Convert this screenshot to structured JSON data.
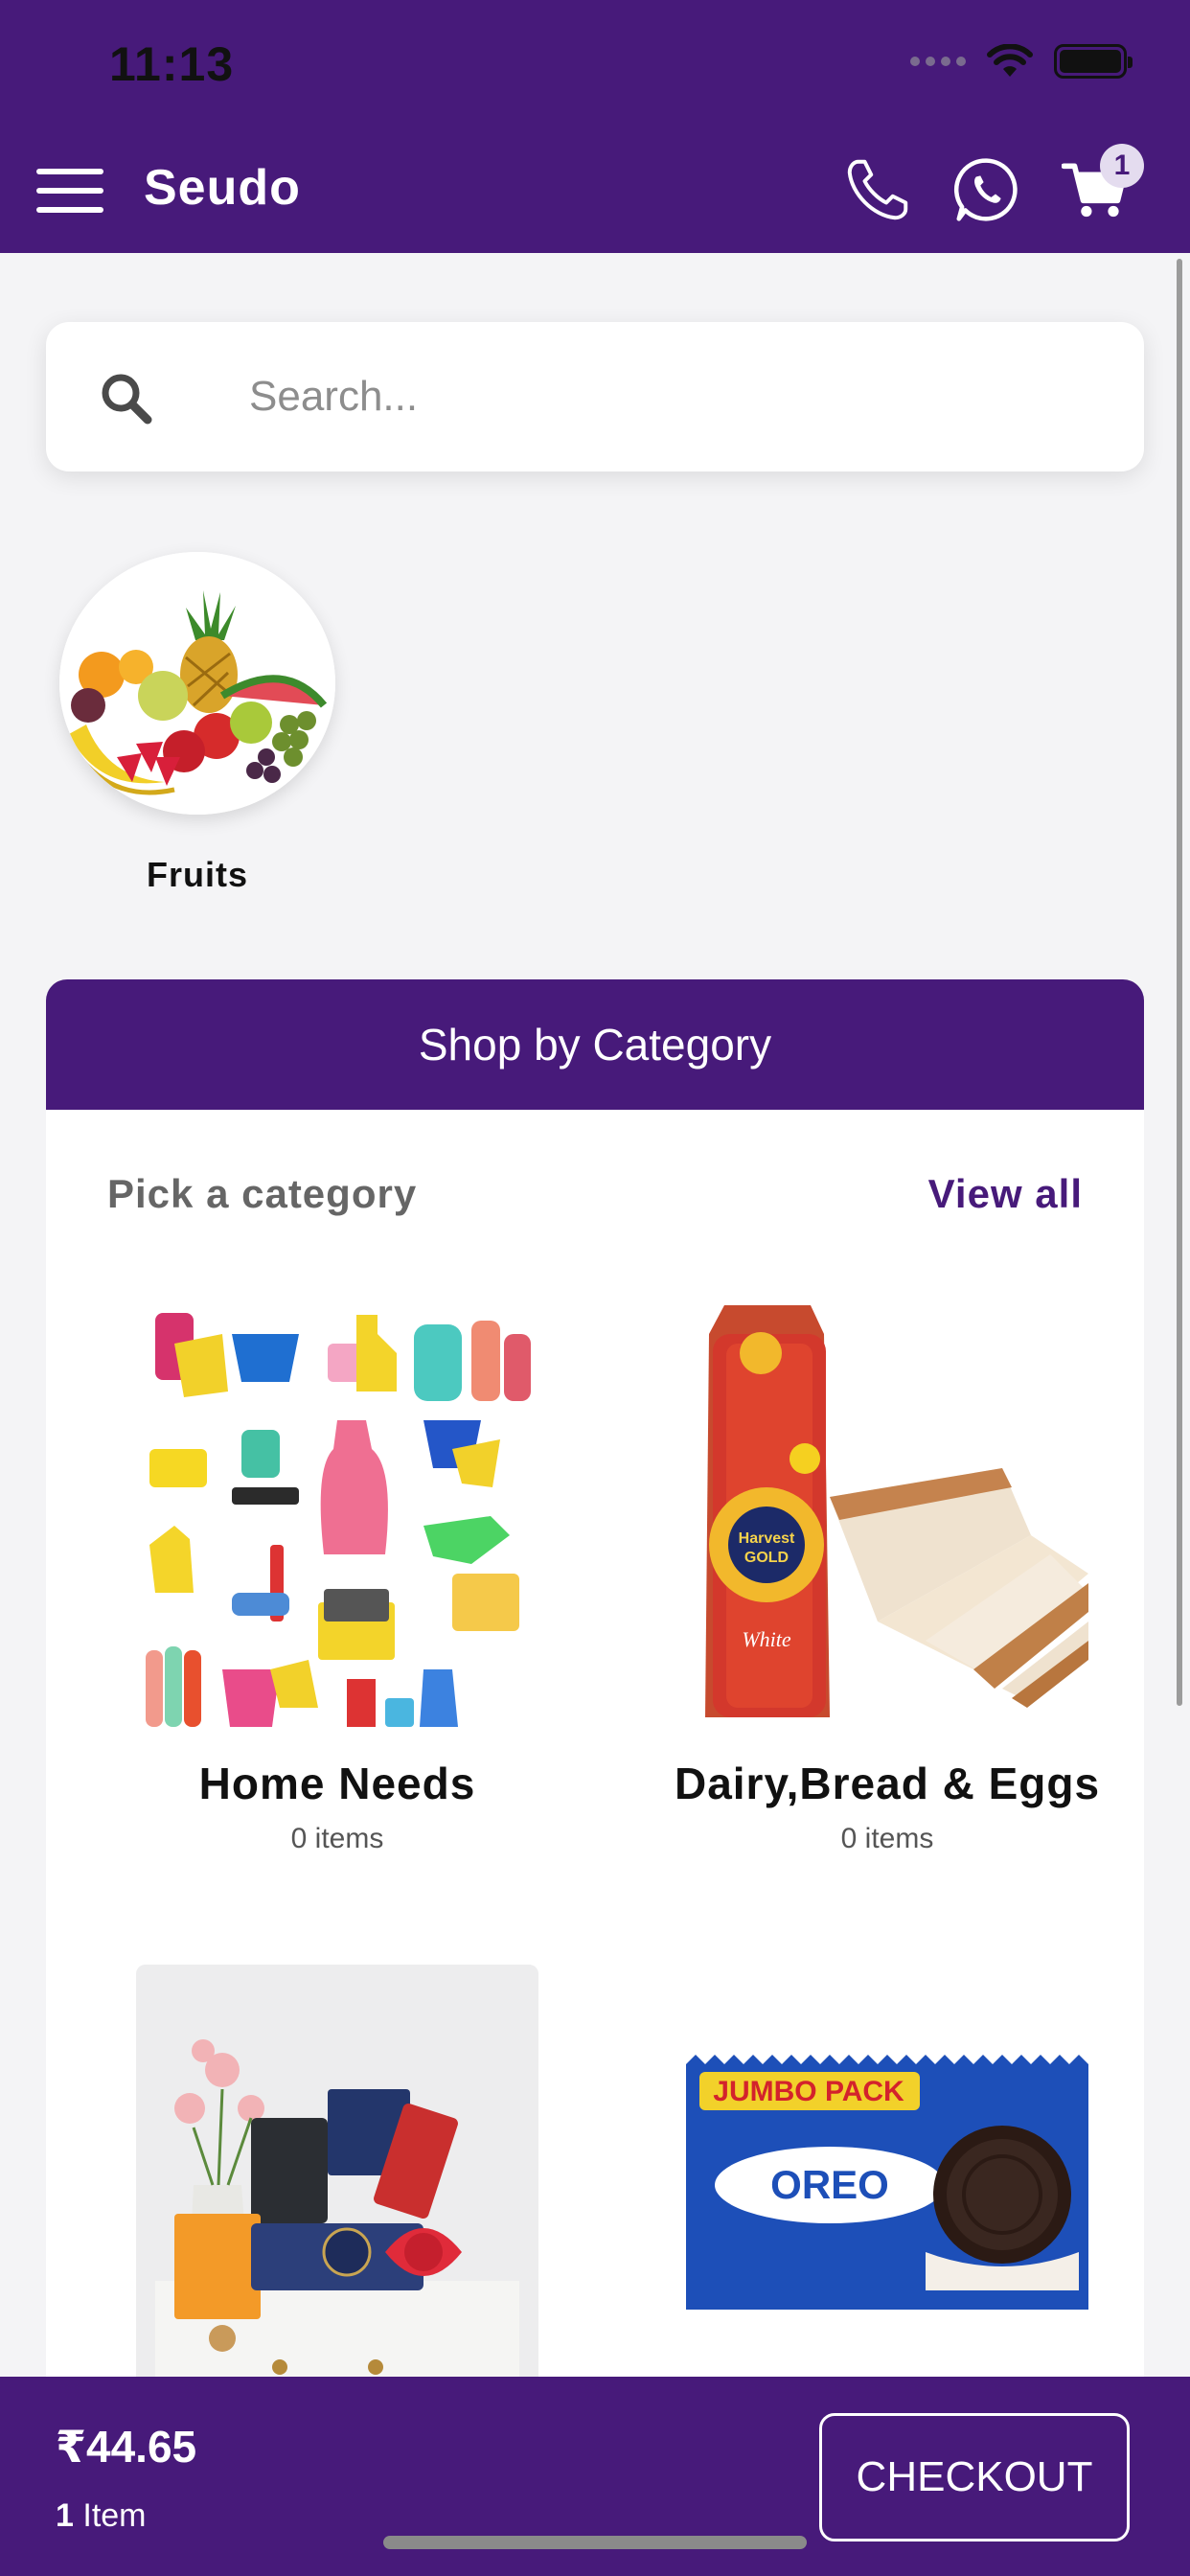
{
  "status": {
    "time": "11:13"
  },
  "header": {
    "brand": "Seudo",
    "menu_icon": "hamburger-menu-icon",
    "phone_icon": "phone-icon",
    "whatsapp_icon": "whatsapp-icon",
    "cart_icon": "cart-icon",
    "cart_count": "1",
    "color": "#471a7a"
  },
  "search": {
    "placeholder": "Search...",
    "value": ""
  },
  "top_categories": [
    {
      "label": "Fruits"
    }
  ],
  "shop_section": {
    "title": "Shop by Category",
    "subtitle": "Pick a category",
    "view_all": "View all",
    "categories": [
      {
        "name": "Home Needs",
        "count": "0 items"
      },
      {
        "name": "Dairy,Bread & Eggs",
        "count": "0 items"
      },
      {
        "name": "",
        "count": ""
      },
      {
        "name": "",
        "count": ""
      }
    ]
  },
  "cart_bar": {
    "price": "₹44.65",
    "item_count": "1",
    "item_label": " Item",
    "checkout": "CHECKOUT"
  }
}
